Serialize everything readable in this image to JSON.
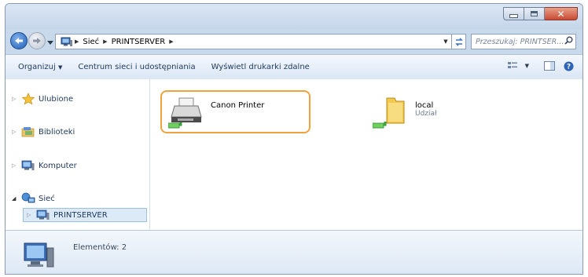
{
  "address": {
    "crumbs": [
      "Sieć",
      "PRINTSERVER"
    ],
    "search_placeholder": "Przeszukaj: PRINTSER..."
  },
  "toolbar": {
    "organize": "Organizuj",
    "network_center": "Centrum sieci i udostępniania",
    "view_remote_printers": "Wyświetl drukarki zdalne"
  },
  "nav": {
    "favorites": "Ulubione",
    "libraries": "Biblioteki",
    "computer": "Komputer",
    "network": "Sieć",
    "printserver": "PRINTSERVER"
  },
  "items": [
    {
      "name": "Canon Printer",
      "subtitle": ""
    },
    {
      "name": "local",
      "subtitle": "Udział"
    }
  ],
  "details": {
    "count_text": "Elementów: 2"
  },
  "colors": {
    "highlight_border": "#f0a33c",
    "selection_bg": "#dceaf8"
  }
}
